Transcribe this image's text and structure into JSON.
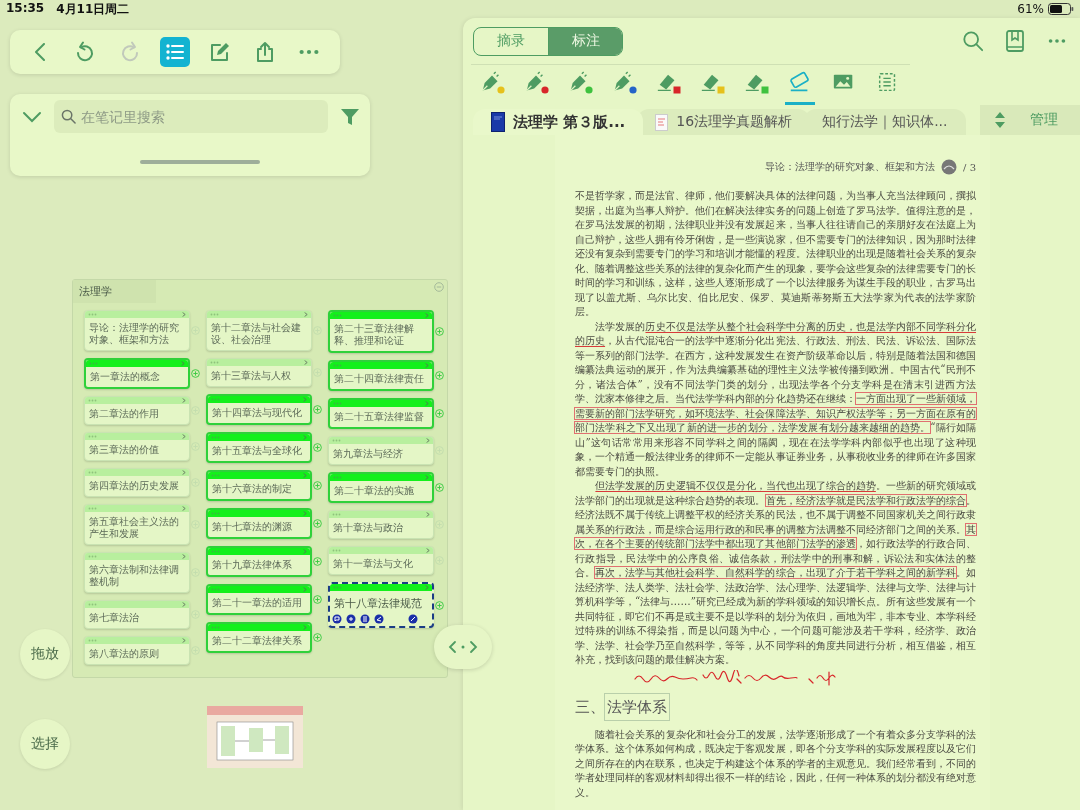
{
  "status_bar": {
    "time": "15:35",
    "date": "4月11日周二",
    "battery": "61%"
  },
  "notes_toolbar": {
    "buttons": [
      {
        "kind": "back",
        "selected": false,
        "disabled": false
      },
      {
        "kind": "undo",
        "selected": false,
        "disabled": false
      },
      {
        "kind": "redo",
        "selected": false,
        "disabled": true
      },
      {
        "kind": "outline",
        "selected": true,
        "disabled": false
      },
      {
        "kind": "edit",
        "selected": false,
        "disabled": false
      },
      {
        "kind": "share",
        "selected": false,
        "disabled": false
      },
      {
        "kind": "more",
        "selected": false,
        "disabled": false
      }
    ]
  },
  "notes_search": {
    "placeholder": "在笔记里搜索"
  },
  "mind_map": {
    "title": "法理学",
    "columns": [
      [
        {
          "label": "导论：法理学的研究对象、框架和方法",
          "highlighted": false,
          "selected": false
        },
        {
          "label": "第一章法的概念",
          "highlighted": true,
          "selected": false
        },
        {
          "label": "第二章法的作用",
          "highlighted": false,
          "selected": false
        },
        {
          "label": "第三章法的价值",
          "highlighted": false,
          "selected": false
        },
        {
          "label": "第四章法的历史发展",
          "highlighted": false,
          "selected": false
        },
        {
          "label": "第五章社会主义法的产生和发展",
          "highlighted": false,
          "selected": false
        },
        {
          "label": "第六章法制和法律调整机制",
          "highlighted": false,
          "selected": false
        },
        {
          "label": "第七章法治",
          "highlighted": false,
          "selected": false
        },
        {
          "label": "第八章法的原则",
          "highlighted": false,
          "selected": false
        }
      ],
      [
        {
          "label": "第十二章法与社会建设、社会治理",
          "highlighted": false,
          "selected": false
        },
        {
          "label": "第十三章法与人权",
          "highlighted": false,
          "selected": false
        },
        {
          "label": "第十四章法与现代化",
          "highlighted": true,
          "selected": false
        },
        {
          "label": "第十五章法与全球化",
          "highlighted": true,
          "selected": false
        },
        {
          "label": "第十六章法的制定",
          "highlighted": true,
          "selected": false
        },
        {
          "label": "第十七章法的渊源",
          "highlighted": true,
          "selected": false
        },
        {
          "label": "第十九章法律体系",
          "highlighted": true,
          "selected": false
        },
        {
          "label": "第二十一章法的适用",
          "highlighted": true,
          "selected": false
        },
        {
          "label": "第二十二章法律关系",
          "highlighted": true,
          "selected": false
        }
      ],
      [
        {
          "label": "第二十三章法律解释、推理和论证",
          "highlighted": true,
          "selected": false
        },
        {
          "label": "第二十四章法律责任",
          "highlighted": true,
          "selected": false
        },
        {
          "label": "第二十五章法律监督",
          "highlighted": true,
          "selected": false
        },
        {
          "label": "第九章法与经济",
          "highlighted": false,
          "selected": false
        },
        {
          "label": "第二十章法的实施",
          "highlighted": true,
          "selected": false
        },
        {
          "label": "第十章法与政治",
          "highlighted": false,
          "selected": false
        },
        {
          "label": "第十一章法与文化",
          "highlighted": false,
          "selected": false
        },
        {
          "label": "第十八章法律规范",
          "highlighted": true,
          "selected": true
        }
      ]
    ]
  },
  "side_buttons": [
    {
      "label": "拖放"
    },
    {
      "label": "选择"
    }
  ],
  "reader": {
    "modes": [
      {
        "label": "摘录",
        "selected": false
      },
      {
        "label": "标注",
        "selected": true
      }
    ],
    "tools": [
      {
        "kind": "pen",
        "color": "#e6c11c",
        "selected": false
      },
      {
        "kind": "pen",
        "color": "#d8262a",
        "selected": false
      },
      {
        "kind": "pen",
        "color": "#3fc23f",
        "selected": false
      },
      {
        "kind": "pen",
        "color": "#2563c8",
        "selected": false
      },
      {
        "kind": "highlighter",
        "color": "#d8262a",
        "selected": false
      },
      {
        "kind": "highlighter",
        "color": "#e6c11c",
        "selected": false
      },
      {
        "kind": "highlighter",
        "color": "#3fc23f",
        "selected": false
      },
      {
        "kind": "eraser",
        "selected": true
      },
      {
        "kind": "image",
        "selected": false
      },
      {
        "kind": "select",
        "selected": false
      }
    ],
    "tabs": [
      {
        "kind": "book",
        "label": "法理学 第３版...",
        "selected": true
      },
      {
        "kind": "document",
        "label": "16法理学真题解析",
        "selected": false
      },
      {
        "kind": "plain",
        "label": "知行法学｜知识体...",
        "selected": false
      }
    ],
    "manage": "管理",
    "page": {
      "header": "导论：法理学的研究对象、框架和方法",
      "page_number": "/ 3",
      "blocks": [
        {
          "kind": "continued",
          "segments": [
            {
              "text": "不是哲学家，而是法官、律师，他们要解决具体的法律问题，为当事人充当法律顾问，撰拟契据，出庭为当事人辩护。他们在解决法律实务的问题上创造了罗马法学。值得注意的是，在罗马法发展的初期，法律职业并没有发展起来，当事人往往请自己的亲朋好友在法庭上为自己辩护，这些人拥有伶牙俐齿，是一些演说家，但不需要专门的法律知识，因为那时法律还没有复杂到需要专门的学习和培训才能懂的程度。法律职业的出现是随着社会关系的复杂化、随着调整这些关系的法律的复杂化而产生的现象，要学会这些复杂的法律需要专门的长时间的学习和训练，这样，这些人逐渐形成了一个以法律服务为谋生手段的职业，古罗马出现了以盖尤斯、乌尔比安、伯比尼安、保罗、莫迪斯蒂努斯五大法学家为代表的法学家阶层。"
            }
          ]
        },
        {
          "kind": "paragraph",
          "segments": [
            {
              "text": "法学发展的"
            },
            {
              "text": "历史不仅是法学从整个社会科学中分离的历史，也是法学内部不同学科分化的历史",
              "underlined": true
            },
            {
              "text": "，从古代混沌合一的法学中逐渐分化出宪法、行政法、刑法、民法、诉讼法、国际法等一系列的部门法学。在西方，这种发展发生在资产阶级革命以后，特别是随着法国和德国编纂法典运动的展开，作为法典编纂基础的理性主义法学被传播到欧洲。中国古代“民刑不分，诸法合体”，没有不同法学门类的划分，出现法学各个分支学科是在清末引进西方法学、沈家本修律之后。当代法学学科内部的分化趋势还在继续："
            },
            {
              "text": "一方面出现了一些新领域，需要新的部门法学研究，如环境法学、社会保障法学、知识产权法学等；另一方面在原有的部门法学科之下又出现了新的进一步的划分，法学发展有划分越来越细的趋势。",
              "boxed": true
            },
            {
              "text": "“隔行如隔山”这句话常常用来形容不同学科之间的隔阂，现在在法学学科内部似乎也出现了这种现象，一个精通一般法律业务的律师不一定能从事证券业务，从事税收业务的律师在许多国家都需要专门的执照。"
            }
          ]
        },
        {
          "kind": "paragraph",
          "segments": [
            {
              "text": "但法学发展的历史逻辑不仅仅是分化，当代也出现了综合的趋势",
              "underlined": true
            },
            {
              "text": "。一些新的研究领域或法学部门的出现就是这种综合趋势的表现。"
            },
            {
              "text": "首先，经济法学就是民法学和行政法学的综合",
              "boxed": true
            },
            {
              "text": "。经济法既不属于传统上调整平权的经济关系的民法，也不属于调整不同国家机关之间行政隶属关系的行政法，而是综合运用行政的和民事的调整方法调整不同经济部门之间的关系。"
            },
            {
              "text": "其次，在各个主要的传统部门法学中都出现了其他部门法学的渗透",
              "boxed": true
            },
            {
              "text": "，如行政法学的行政合同、行政指导，民法学中的公序良俗、诚信条款，刑法学中的刑事和解，诉讼法和实体法的整合。"
            },
            {
              "text": "再次，法学与其他社会科学、自然科学的综合，出现了介于若干学科之间的新学科",
              "boxed": true
            },
            {
              "text": "。如法经济学、法人类学、法社会学、法政治学、法心理学、法逻辑学、法律与文学、法律与计算机科学等，“法律与……”研究已经成为新的学科领域的知识增长点。所有这些发展有一个共同特征，即它们不再是或主要不是以学科的划分为依归，画地为牢，非本专业、本学科经过特殊的训练不得染指，而是以问题为中心，一个问题可能涉及若干学科，经济学、政治学、法学、社会学乃至自然科学，等等，从不同学科的角度共同进行分析，相互借鉴，相互补充，找到该问题的最佳解决方案。"
            }
          ]
        },
        {
          "kind": "heading",
          "segments": [
            {
              "text": "三、"
            },
            {
              "text": "法学体系",
              "framed": true
            }
          ]
        },
        {
          "kind": "paragraph",
          "segments": [
            {
              "text": "随着社会关系的复杂化和社会分工的发展，法学逐渐形成了一个有着众多分支学科的法学体系。这个体系如何构成，既决定于客观发展，即各个分支学科的实际发展程度以及它们之间所存在的内在联系，也决定于构建这个体系的学者的主观意见。我们经常看到，不同的学者处理同样的客观材料却得出很不一样的结论，因此，任何一种体系的划分都没有绝对意义。"
            }
          ]
        }
      ]
    }
  }
}
